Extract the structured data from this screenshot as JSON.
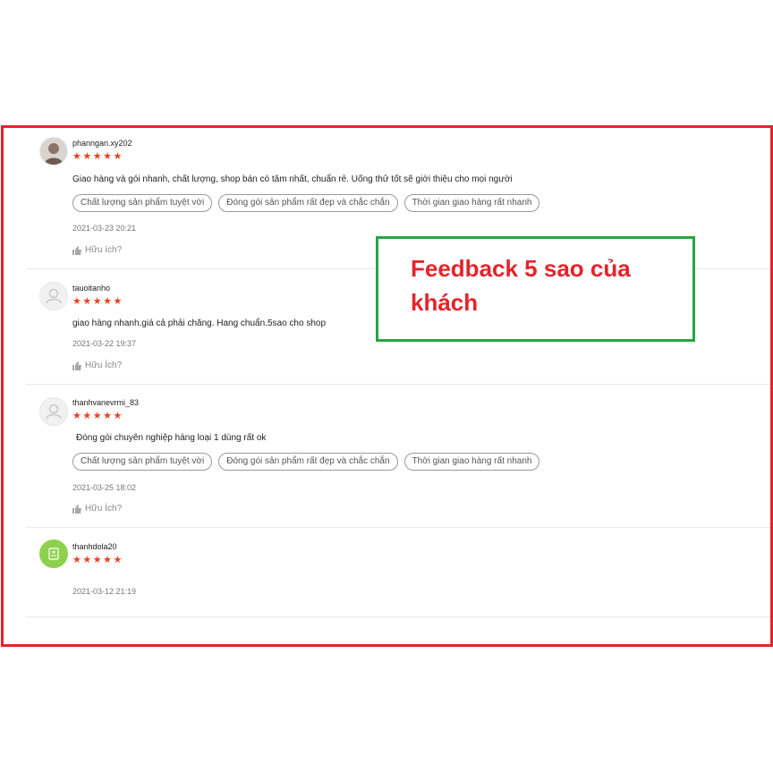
{
  "reviews": [
    {
      "username": "phanngan.xy202",
      "rating": 5,
      "stars": "★★★★★",
      "comment": "Giao hàng và gói nhanh, chất lượng, shop bán có tâm nhất, chuẩn rẻ. Uống thử tốt sẽ giới thiệu cho mọi người",
      "tags": [
        "Chất lượng sản phẩm tuyệt vời",
        "Đóng gói sản phẩm rất đẹp và chắc chắn",
        "Thời gian giao hàng rất nhanh"
      ],
      "date": "2021-03-23 20:21",
      "helpful": "Hữu ích?"
    },
    {
      "username": "tauoitanho",
      "rating": 5,
      "stars": "★★★★★",
      "comment": "giao hàng nhanh.giá cả phải chăng. Hang chuẩn.5sao cho shop",
      "tags": [],
      "date": "2021-03-22 19:37",
      "helpful": "Hữu Ích?"
    },
    {
      "username": "thanhvanevrmi_83",
      "rating": 5,
      "stars": "★★★★★",
      "comment": "Đóng gói chuyên nghiệp hàng loại 1 dùng rất ok",
      "tags": [
        "Chất lượng sản phẩm tuyệt vời",
        "Đóng gói sản phẩm rất đẹp và chắc chắn",
        "Thời gian giao hàng rất nhanh"
      ],
      "date": "2021-03-25 18:02",
      "helpful": "Hữu Ích?"
    },
    {
      "username": "thanhdola20",
      "rating": 5,
      "stars": "★★★★★",
      "comment": "",
      "tags": [],
      "date": "2021-03-12 21:19",
      "helpful": ""
    }
  ],
  "callout": {
    "text": "Feedback 5 sao của khách"
  },
  "colors": {
    "frame": "#e3242b",
    "callout_border": "#27a544",
    "callout_text": "#e3242b",
    "stars": "#e6431f"
  }
}
